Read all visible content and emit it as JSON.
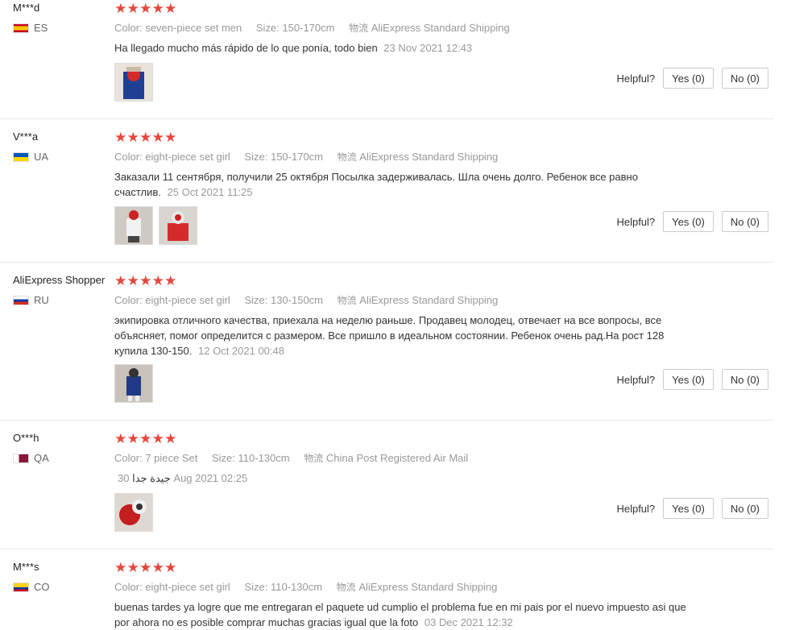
{
  "labels": {
    "color": "Color:",
    "size": "Size:",
    "shipping": "物流",
    "helpful": "Helpful?"
  },
  "star_count": 5,
  "reviews": [
    {
      "user": "M***d",
      "country": "ES",
      "flag_colors": [
        "#c60b1e",
        "#ffc400",
        "#c60b1e"
      ],
      "color": "seven-piece set men",
      "size": "150-170cm",
      "shipping": "AliExpress Standard Shipping",
      "text": "Ha llegado mucho más rápido de lo que ponía, todo bien",
      "date": "23 Nov 2021 12:43",
      "yes": "Yes (0)",
      "no": "No (0)"
    },
    {
      "user": "V***a",
      "country": "UA",
      "flag_colors": [
        "#0057b7",
        "#ffd700"
      ],
      "color": "eight-piece set girl",
      "size": "150-170cm",
      "shipping": "AliExpress Standard Shipping",
      "text": "Заказали 11 сентября, получили 25 октября Посылка задерживалась. Шла очень долго. Ребенок все равно счастлив.",
      "date": "25 Oct 2021 11:25",
      "yes": "Yes (0)",
      "no": "No (0)"
    },
    {
      "user": "AliExpress Shopper",
      "country": "RU",
      "flag_colors": [
        "#ffffff",
        "#0039a6",
        "#d52b1e"
      ],
      "color": "eight-piece set girl",
      "size": "130-150cm",
      "shipping": "AliExpress Standard Shipping",
      "text": "экипировка отличного качества, приехала на неделю раньше. Продавец молодец, отвечает на все вопросы, все объясняет, помог определится с размером. Все пришло в идеальном состоянии. Ребенок очень рад.На рост 128 купила 130-150.",
      "date": "12 Oct 2021 00:48",
      "yes": "Yes (0)",
      "no": "No (0)"
    },
    {
      "user": "O***h",
      "country": "QA",
      "flag_colors": [
        "#ffffff",
        "#8a1538"
      ],
      "color": "7 piece Set",
      "size": "110-130cm",
      "shipping": "China Post Registered Air Mail",
      "text": "جيدة جدا",
      "date": "30 Aug 2021 02:25",
      "yes": "Yes (0)",
      "no": "No (0)"
    },
    {
      "user": "M***s",
      "country": "CO",
      "flag_colors": [
        "#fcd116",
        "#003893",
        "#ce1126"
      ],
      "color": "eight-piece set girl",
      "size": "110-130cm",
      "shipping": "AliExpress Standard Shipping",
      "text": "buenas tardes ya logre que me entregaran el paquete ud cumplio el problema fue en mi pais por el nuevo impuesto asi que por ahora no es posible comprar muchas gracias igual que la foto",
      "date": "03 Dec 2021 12:32",
      "yes": "",
      "no": ""
    }
  ]
}
